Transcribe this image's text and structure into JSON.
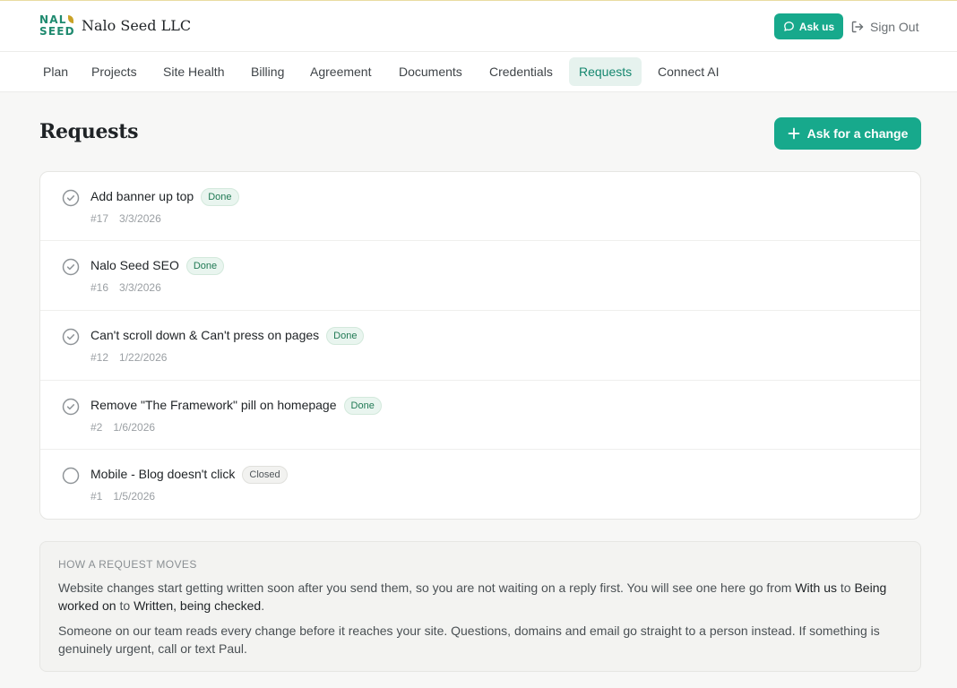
{
  "brand": {
    "logo_line1": "NAL",
    "logo_line2": "SEED",
    "name": "Nalo Seed LLC"
  },
  "header": {
    "ask_us_label": "Ask us",
    "sign_out_label": "Sign Out"
  },
  "nav": {
    "items": [
      {
        "label": "Plan"
      },
      {
        "label": "Projects"
      },
      {
        "label": "Site Health"
      },
      {
        "label": "Billing"
      },
      {
        "label": "Agreement"
      },
      {
        "label": "Documents"
      },
      {
        "label": "Credentials"
      },
      {
        "label": "Requests",
        "active": true
      },
      {
        "label": "Connect AI"
      }
    ]
  },
  "page": {
    "title": "Requests",
    "ask_change_label": "Ask for a change"
  },
  "requests": [
    {
      "title": "Add banner up top",
      "status": "Done",
      "number": "#17",
      "date": "3/3/2026"
    },
    {
      "title": "Nalo Seed SEO",
      "status": "Done",
      "number": "#16",
      "date": "3/3/2026"
    },
    {
      "title": "Can't scroll down & Can't press on pages",
      "status": "Done",
      "number": "#12",
      "date": "1/22/2026"
    },
    {
      "title": "Remove \"The Framework\" pill on homepage",
      "status": "Done",
      "number": "#2",
      "date": "1/6/2026"
    },
    {
      "title": "Mobile - Blog doesn't click",
      "status": "Closed",
      "number": "#1",
      "date": "1/5/2026"
    }
  ],
  "info": {
    "heading": "HOW A REQUEST MOVES",
    "p1_start": "Website changes start getting written soon after you send them, so you are not waiting on a reply first. You will see one here go from ",
    "p1_stage1": "With us",
    "p1_to1": " to ",
    "p1_stage2": "Being worked on",
    "p1_to2": " to ",
    "p1_stage3": "Written, being checked",
    "p1_end": ".",
    "p2": "Someone on our team reads every change before it reaches your site. Questions, domains and email go straight to a person instead. If something is genuinely urgent, call or text Paul."
  },
  "colors": {
    "accent": "#17a98c",
    "accent_text": "#15876f",
    "done_badge_bg": "#e9f5ef",
    "closed_badge_bg": "#f2f2f0"
  },
  "icons": {
    "ask_us": "chat-bubble-icon",
    "sign_out": "sign-out-icon",
    "ask_change": "plus-icon",
    "done_status": "check-circle-icon",
    "closed_status": "empty-circle-icon"
  }
}
